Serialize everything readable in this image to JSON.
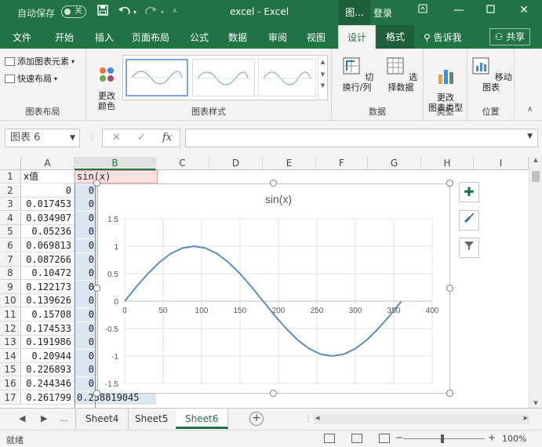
{
  "titlebar": {
    "autosave_label": "自动保存",
    "autosave_state": "关",
    "doc_title": "excel  -  Excel",
    "ctx_title": "图...",
    "login": "登录",
    "undo_icon": "undo-icon",
    "save_icon": "save-icon"
  },
  "tabs": {
    "items": [
      "文件",
      "开始",
      "插入",
      "页面布局",
      "公式",
      "数据",
      "审阅",
      "视图"
    ],
    "design": "设计",
    "format": "格式",
    "tell": "告诉我",
    "share": "共享"
  },
  "ribbon": {
    "add_element": "添加图表元素",
    "quick_layout": "快速布局",
    "change_color": "更改\n颜色",
    "switch_rowcol": "切换行/列",
    "select_data": "选择数据",
    "change_type": "更改\n图表类型",
    "move_chart": "移动图表",
    "groups": {
      "layout": "图表布局",
      "styles": "图表样式",
      "data": "数据",
      "type": "类型",
      "location": "位置"
    }
  },
  "formula": {
    "name_box": "图表 6",
    "fx": "fx",
    "cancel": "✕",
    "confirm": "✓",
    "value": ""
  },
  "grid": {
    "columns": [
      "A",
      "B",
      "C",
      "D",
      "E",
      "F",
      "G",
      "H",
      "I"
    ],
    "rows": [
      "1",
      "2",
      "3",
      "4",
      "5",
      "6",
      "7",
      "8",
      "9",
      "10",
      "11",
      "12",
      "13",
      "14",
      "15",
      "16",
      "17"
    ],
    "header_a": "x值",
    "header_b": "sin(x)",
    "a_values": [
      "0",
      "0.017453",
      "0.034907",
      "0.05236",
      "0.069813",
      "0.087266",
      "0.10472",
      "0.122173",
      "0.139626",
      "0.15708",
      "0.174533",
      "0.191986",
      "0.20944",
      "0.226893",
      "0.244346",
      "0.261799"
    ],
    "b_visible": [
      "0",
      "0",
      "0",
      "0",
      "0",
      "0",
      "0",
      "0",
      "0",
      "0",
      "0",
      "0",
      "0",
      "0",
      "0",
      "0.258819045"
    ]
  },
  "chart_data": {
    "type": "line",
    "title": "sin(x)",
    "x": [
      0,
      15,
      30,
      45,
      60,
      75,
      90,
      105,
      120,
      135,
      150,
      165,
      180,
      195,
      210,
      225,
      240,
      255,
      270,
      285,
      300,
      315,
      330,
      345,
      360
    ],
    "series": [
      {
        "name": "sin(x)",
        "values": [
          0,
          0.259,
          0.5,
          0.707,
          0.866,
          0.966,
          1,
          0.966,
          0.866,
          0.707,
          0.5,
          0.259,
          0,
          -0.259,
          -0.5,
          -0.707,
          -0.866,
          -0.966,
          -1,
          -0.966,
          -0.866,
          -0.707,
          -0.5,
          -0.259,
          0
        ]
      }
    ],
    "xlim": [
      0,
      400
    ],
    "ylim": [
      -1.5,
      1.5
    ],
    "xticks": [
      "0",
      "50",
      "100",
      "150",
      "200",
      "250",
      "300",
      "350",
      "400"
    ],
    "yticks": [
      "1.5",
      "1",
      "0.5",
      "0",
      "-0.5",
      "-1",
      "-1.5"
    ],
    "grid": true,
    "line_color": "#5b8db8"
  },
  "sheets": {
    "tabs": [
      "Sheet4",
      "Sheet5",
      "Sheet6"
    ],
    "active": "Sheet6",
    "more": "...",
    "add": "+"
  },
  "status": {
    "ready": "就绪",
    "zoom": "100%",
    "minus": "−",
    "plus": "+"
  },
  "colors": {
    "excel_green": "#217346",
    "selection_blue": "#dae7f3"
  }
}
